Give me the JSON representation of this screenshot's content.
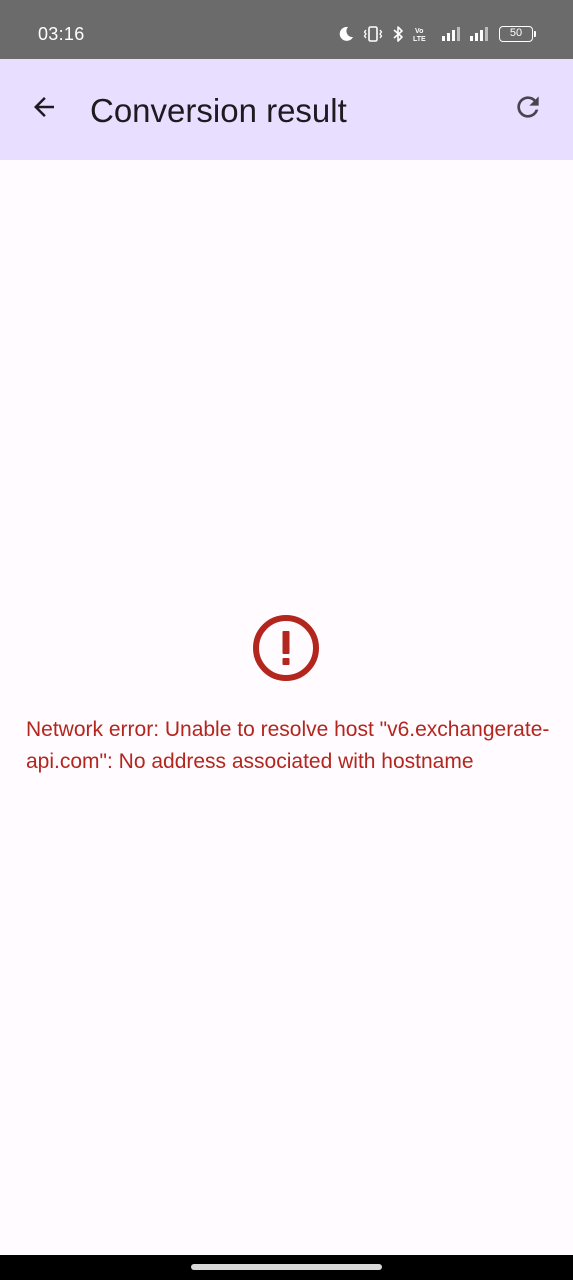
{
  "status_bar": {
    "time": "03:16",
    "battery_level": "50",
    "icons": [
      "moon-icon",
      "vibrate-icon",
      "bluetooth-icon",
      "volte-icon",
      "signal-icon",
      "signal-icon",
      "battery-icon"
    ]
  },
  "app_bar": {
    "title": "Conversion result",
    "back_icon": "arrow-left-icon",
    "refresh_icon": "refresh-icon",
    "background_color": "#e8deff"
  },
  "error": {
    "icon": "error-circle-icon",
    "message": "Network error: Unable to resolve host \"v6.exchangerate-api.com\": No address associated with hostname",
    "color": "#b3261e"
  }
}
